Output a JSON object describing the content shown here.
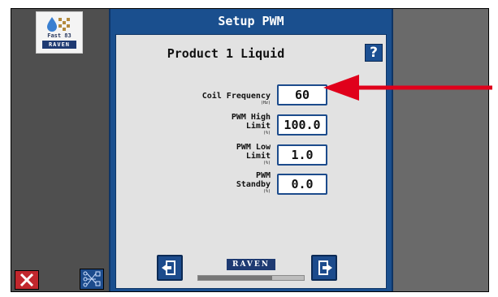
{
  "app": {
    "logo": {
      "title": "Fast 83",
      "brand": "RAVEN"
    },
    "close_icon": "close-icon",
    "bottom_icon": "network-icon"
  },
  "dialog": {
    "title": "Setup PWM",
    "product_title": "Product 1 Liquid",
    "help_label": "?",
    "fields": [
      {
        "label_lines": [
          "Coil Frequency"
        ],
        "unit": "(Hz)",
        "value": "60"
      },
      {
        "label_lines": [
          "PWM High",
          "Limit"
        ],
        "unit": "(%)",
        "value": "100.0"
      },
      {
        "label_lines": [
          "PWM Low",
          "Limit"
        ],
        "unit": "(%)",
        "value": "1.0"
      },
      {
        "label_lines": [
          "PWM",
          "Standby"
        ],
        "unit": "(%)",
        "value": "0.0"
      }
    ],
    "footer": {
      "brand": "RAVEN",
      "progress": 0.7,
      "back_icon": "back-icon",
      "next_icon": "next-icon"
    }
  },
  "annotation": {
    "arrow_color": "#e0001b"
  },
  "colors": {
    "dialog_blue": "#1a4f8e",
    "panel_gray": "#e2e2e2"
  }
}
